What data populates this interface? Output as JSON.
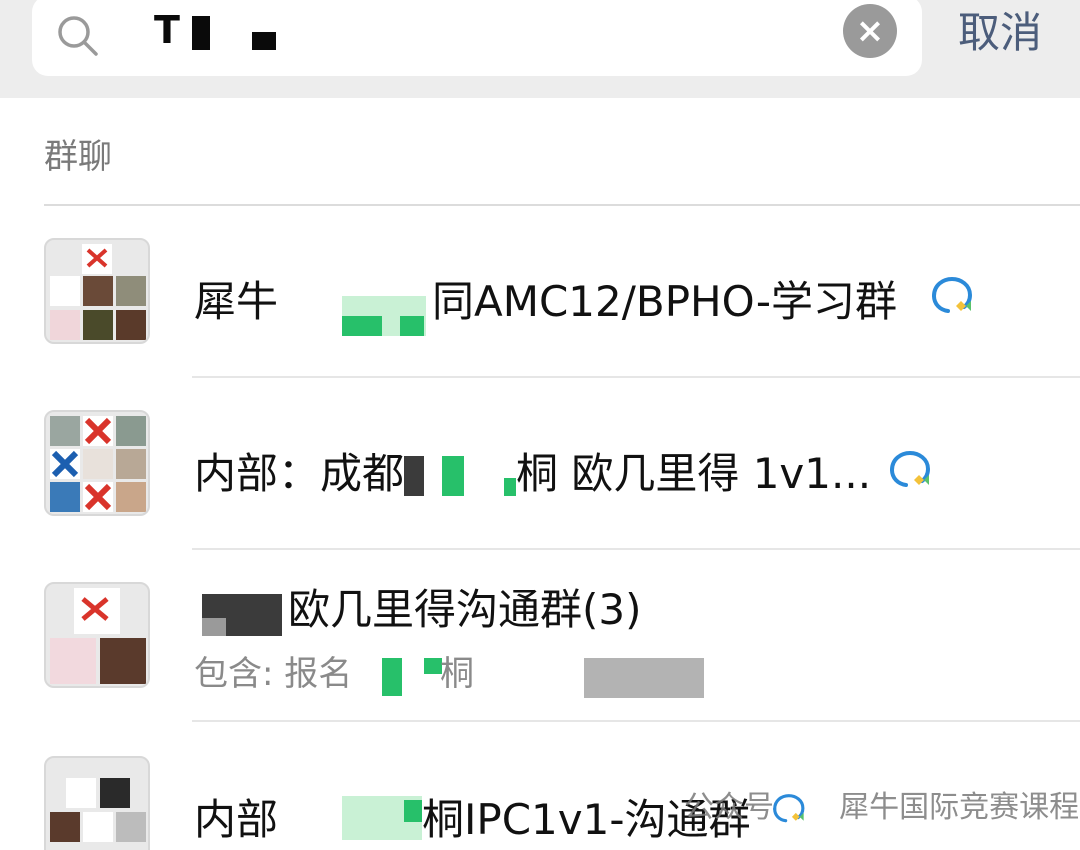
{
  "search": {
    "query": "T",
    "cancel_label": "取消"
  },
  "section": {
    "title": "群聊"
  },
  "results": [
    {
      "title_prefix": "犀牛",
      "title_suffix": "同AMC12/BPHO-学习群"
    },
    {
      "title_prefix": "内部：成都",
      "title_suffix": "桐 欧几里得 1v1..."
    },
    {
      "title_suffix": "欧几里得沟通群(3)",
      "sub_prefix": "包含: 报名",
      "sub_mid": "桐"
    },
    {
      "title_prefix": "内部",
      "title_suffix": "桐IPC1v1-沟通群"
    }
  ],
  "watermark": {
    "left": "公众号",
    "right": "犀牛国际竞赛课程"
  },
  "colors": {
    "accent_cancel": "#4c5d7b",
    "wecom_blue": "#2b8ad9",
    "wecom_yellow": "#f3c23a"
  }
}
